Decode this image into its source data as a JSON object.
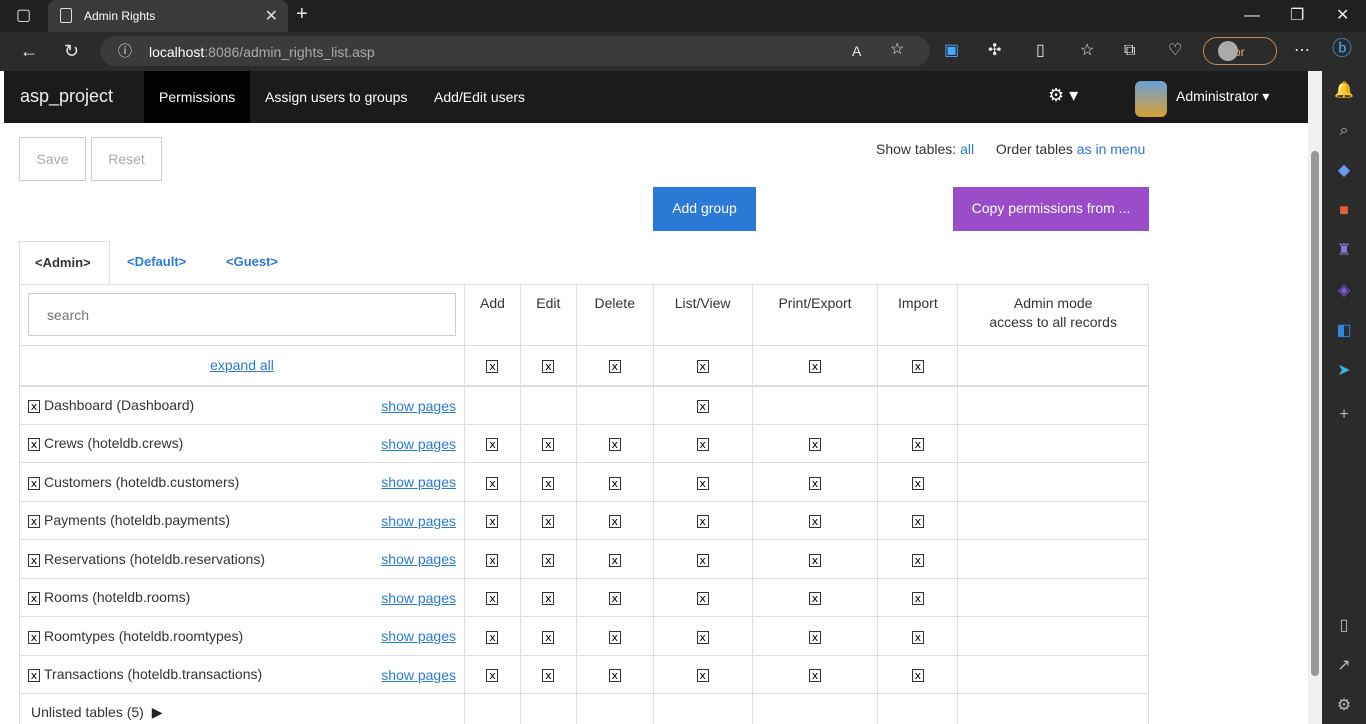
{
  "browser": {
    "tab_title": "Admin Rights",
    "url_host": "localhost",
    "url_rest": ":8086/admin_rights_list.asp",
    "error_label": "Error"
  },
  "navbar": {
    "brand": "asp_project",
    "items": [
      "Permissions",
      "Assign users to groups",
      "Add/Edit users"
    ],
    "user": "Administrator"
  },
  "toolbar": {
    "save": "Save",
    "reset": "Reset",
    "show_tables_label": "Show tables:",
    "show_tables_value": "all",
    "order_tables_label": "Order tables",
    "order_tables_value": "as in menu",
    "add_group": "Add group",
    "copy_permissions": "Copy permissions from ..."
  },
  "group_tabs": [
    "<Admin>",
    "<Default>",
    "<Guest>"
  ],
  "table": {
    "search_placeholder": "search",
    "columns": [
      "Add",
      "Edit",
      "Delete",
      "List/View",
      "Print/Export",
      "Import"
    ],
    "admin_mode_line1": "Admin mode",
    "admin_mode_line2": "access to all records",
    "expand_all": "expand all",
    "show_pages": "show pages",
    "check_mark": "x",
    "rows": [
      {
        "name": "Dashboard (Dashboard)",
        "perms": [
          false,
          false,
          false,
          true,
          false,
          false
        ]
      },
      {
        "name": "Crews (hoteldb.crews)",
        "perms": [
          true,
          true,
          true,
          true,
          true,
          true
        ]
      },
      {
        "name": "Customers (hoteldb.customers)",
        "perms": [
          true,
          true,
          true,
          true,
          true,
          true
        ]
      },
      {
        "name": "Payments (hoteldb.payments)",
        "perms": [
          true,
          true,
          true,
          true,
          true,
          true
        ]
      },
      {
        "name": "Reservations (hoteldb.reservations)",
        "perms": [
          true,
          true,
          true,
          true,
          true,
          true
        ]
      },
      {
        "name": "Rooms (hoteldb.rooms)",
        "perms": [
          true,
          true,
          true,
          true,
          true,
          true
        ]
      },
      {
        "name": "Roomtypes (hoteldb.roomtypes)",
        "perms": [
          true,
          true,
          true,
          true,
          true,
          true
        ]
      },
      {
        "name": "Transactions (hoteldb.transactions)",
        "perms": [
          true,
          true,
          true,
          true,
          true,
          true
        ]
      }
    ],
    "unlisted": "Unlisted tables (5)"
  }
}
